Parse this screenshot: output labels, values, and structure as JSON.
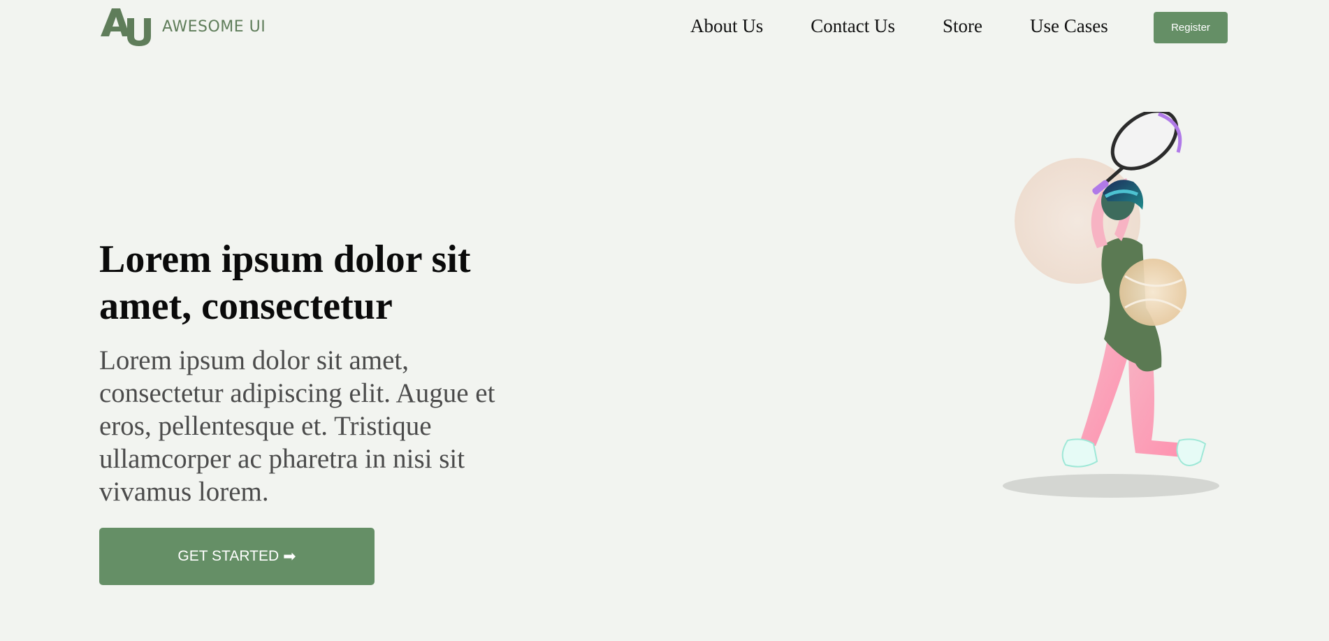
{
  "header": {
    "logo_text": "AWESOME UI",
    "nav": [
      {
        "label": "About Us"
      },
      {
        "label": "Contact Us"
      },
      {
        "label": "Store"
      },
      {
        "label": "Use Cases"
      }
    ],
    "register_label": "Register"
  },
  "hero": {
    "title": "Lorem ipsum dolor sit amet, consectetur",
    "text": "Lorem ipsum dolor sit amet, consectetur adipiscing elit. Augue et eros, pellentesque et. Tristique ullamcorper ac pharetra in nisi sit vivamus lorem.",
    "cta_label": "GET STARTED",
    "cta_icon": "arrow-right-icon"
  },
  "colors": {
    "background": "#f2f4f0",
    "accent": "#658f66",
    "logo": "#5f7d5a"
  }
}
